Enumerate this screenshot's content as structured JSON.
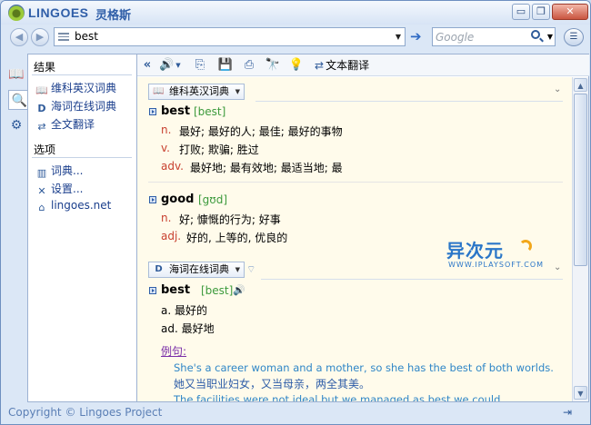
{
  "app": {
    "name": "LINGOES",
    "name_cn": "灵格斯",
    "accent": "#2f5ea8",
    "window_buttons": {
      "minimize": "▭",
      "restore": "❐",
      "close": "✕"
    }
  },
  "address_bar": {
    "query": "best",
    "google_placeholder": "Google",
    "go_glyph": "➔",
    "back_glyph": "◀",
    "forward_glyph": "▶"
  },
  "left_panel": {
    "results_title": "结果",
    "results": [
      {
        "label": "维科英汉词典",
        "icon": "book-icon",
        "glyph": "📖"
      },
      {
        "label": "海词在线词典",
        "icon": "dict-d-icon",
        "glyph": "D"
      },
      {
        "label": "全文翻译",
        "icon": "translate-icon",
        "glyph": "⇄"
      }
    ],
    "options_title": "选项",
    "options": [
      {
        "label": "词典...",
        "icon": "books-icon",
        "glyph": "▥"
      },
      {
        "label": "设置...",
        "icon": "tools-icon",
        "glyph": "✕"
      },
      {
        "label": "lingoes.net",
        "icon": "home-icon",
        "glyph": "⌂"
      }
    ]
  },
  "toolbar": {
    "translate_label": "文本翻译"
  },
  "dict1": {
    "name": "维科英汉词典",
    "entries": [
      {
        "word": "best",
        "phonetic": "[best]",
        "senses": [
          {
            "pos": "n.",
            "def": "最好; 最好的人; 最佳; 最好的事物"
          },
          {
            "pos": "v.",
            "def": "打败; 欺骗; 胜过"
          },
          {
            "pos": "adv.",
            "def": "最好地; 最有效地; 最适当地; 最"
          }
        ]
      },
      {
        "word": "good",
        "phonetic": "[gʊd]",
        "senses": [
          {
            "pos": "n.",
            "def": "好; 慷慨的行为; 好事"
          },
          {
            "pos": "adj.",
            "def": "好的, 上等的, 优良的"
          }
        ]
      }
    ]
  },
  "dict2": {
    "name": "海词在线词典",
    "word": "best",
    "phonetic": "[best]",
    "lines": [
      "a. 最好的",
      "ad. 最好地"
    ],
    "example_label": "例句:",
    "example1_en": "She's a career woman and a mother, so she has the best of both worlds.",
    "example1_cn": "她又当职业妇女，又当母亲，两全其美。",
    "example2_en": "The facilities were not ideal but we managed as best we could."
  },
  "watermark": {
    "cn": "异次元",
    "en": "WWW.IPLAYSOFT.COM"
  },
  "status": {
    "copyright": "Copyright © Lingoes Project"
  }
}
